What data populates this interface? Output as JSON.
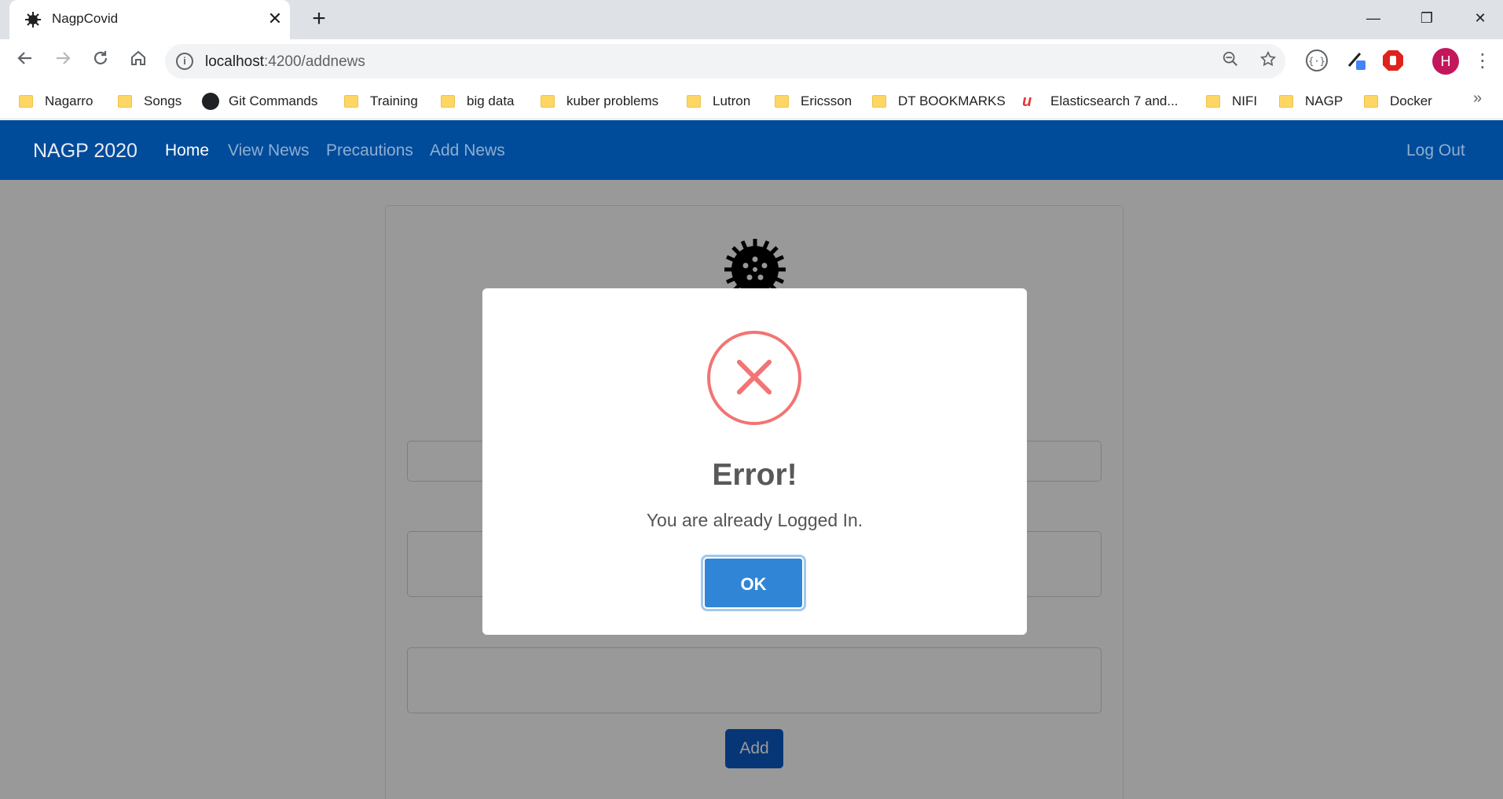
{
  "browser": {
    "tab_title": "NagpCovid",
    "tab_close": "✕",
    "new_tab": "+",
    "url_host": "localhost",
    "url_path": ":4200/addnews",
    "avatar_letter": "H",
    "window": {
      "minimize": "—",
      "restore": "❐",
      "close": "✕"
    }
  },
  "bookmarks": [
    {
      "label": "Nagarro",
      "icon": "folder-icon"
    },
    {
      "label": "Songs",
      "icon": "folder-icon"
    },
    {
      "label": "Git Commands",
      "icon": "github-icon"
    },
    {
      "label": "Training",
      "icon": "folder-icon"
    },
    {
      "label": "big data",
      "icon": "folder-icon"
    },
    {
      "label": "kuber problems",
      "icon": "folder-icon"
    },
    {
      "label": "Lutron",
      "icon": "folder-icon"
    },
    {
      "label": "Ericsson",
      "icon": "folder-icon"
    },
    {
      "label": "DT BOOKMARKS",
      "icon": "folder-icon"
    },
    {
      "label": "Elasticsearch 7 and...",
      "icon": "udemy-icon"
    },
    {
      "label": "NIFI",
      "icon": "folder-icon"
    },
    {
      "label": "NAGP",
      "icon": "folder-icon"
    },
    {
      "label": "Docker",
      "icon": "folder-icon"
    }
  ],
  "bookmarks_more": "»",
  "navbar": {
    "brand": "NAGP 2020",
    "links": [
      "Home",
      "View News",
      "Precautions",
      "Add News"
    ],
    "logout": "Log Out"
  },
  "form": {
    "add_label": "Add"
  },
  "modal": {
    "title": "Error!",
    "message": "You are already Logged In.",
    "ok_label": "OK",
    "icon": "error-x-icon",
    "accent_color": "#f27474",
    "button_color": "#3085d6"
  },
  "colors": {
    "navbar": "#004b9a",
    "add_button": "#0d5bc6"
  }
}
